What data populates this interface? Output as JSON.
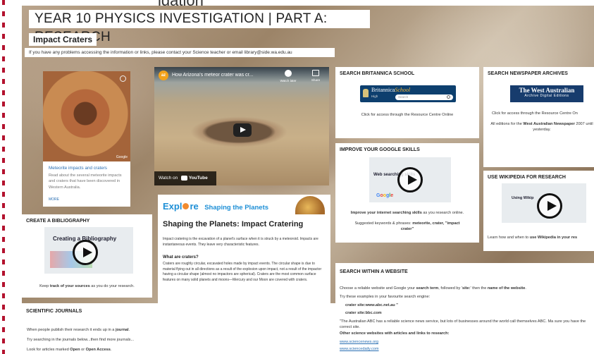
{
  "page_title": "YEAR 10 PHYSICS INVESTIGATION | PART A: RESEARCH",
  "section_heading": "Impact Craters",
  "help_text": "If you have any problems accessing the information or links, please contact your Science teacher or email library@side.wa.edu.au",
  "map_card": {
    "google_label": "Google",
    "link_title": "Meteorite impacts and craters",
    "description": "Read about the several meteorite impacts and craters that have been discovered in Western Australia.",
    "more": "MORE"
  },
  "video_card": {
    "channel_badge": "az",
    "title": "How Arizona's meteor crater was cr...",
    "watch_later": "Watch later",
    "share": "Share",
    "watch_on": "Watch on",
    "youtube": "YouTube"
  },
  "britannica": {
    "title": "SEARCH BRITANNICA SCHOOL",
    "logo_text": "Britannica",
    "logo_suffix": "School",
    "logo_level": "High",
    "search_placeholder": "Search",
    "caption": "Click for access through the Resource Centre Online"
  },
  "newspaper": {
    "title": "SEARCH NEWSPAPER ARCHIVES",
    "logo_line1": "The West Australian",
    "logo_line2": "Archive Digital Editions",
    "caption1": "Click for access through the Resource Centre On",
    "caption2_pre": "All editions for the ",
    "caption2_bold": "West Australian Newspaper",
    "caption2_post": " 2007 until yesterday."
  },
  "google_skills": {
    "title": "IMPROVE YOUR GOOGLE SKILLS",
    "thumb_text": "Web searching skills",
    "line1_bold": "Improve your internet searching skills",
    "line1_rest": " as you research online.",
    "line2_pre": "Suggested keywords & phrases: ",
    "line2_bold": "meteorite, crater, \"impact crater\""
  },
  "wikipedia": {
    "title": "USE WIKIPEDIA FOR RESEARCH",
    "thumb_text": "Using Wikip",
    "caption_pre": "Learn how and when to ",
    "caption_bold": "use Wikipedia in your res"
  },
  "bibliography": {
    "title": "CREATE A BIBLIOGRAPHY",
    "thumb_text": "Creating a Bibliography",
    "caption_pre": "Keep ",
    "caption_bold": "track of your sources",
    "caption_post": " as you do your research."
  },
  "explore": {
    "logo_a": "Expl",
    "logo_b": "re",
    "banner": "Shaping the Planets",
    "heading": "Shaping the Planets: Impact Cratering",
    "intro": "Impact cratering is the excavation of a planet's surface when it is struck by a meteoroid. Impacts are instantaneous events. They leave very characteristic features.",
    "subheading": "What are craters?",
    "body": "Craters are roughly circular, excavated holes made by impact events. The circular shape is due to material flying out in all directions as a result of the explosion upon impact, not a result of the impactor having a circular shape (almost no impactors are spherical). Craters are the most common surface features on many solid planets and moons—Mercury and our Moon are covered with craters."
  },
  "journals": {
    "title": "SCIENTIFIC JOURNALS",
    "line1_pre": "When people publish their research it ends up in a ",
    "line1_bold": "journal",
    "line1_post": ".",
    "line2": "Try searching in the journals below...then find more journals...",
    "line3_pre": "Look for articles marked ",
    "line3_b1": "Open",
    "line3_mid": " or ",
    "line3_b2": "Open Access",
    "line3_post": "."
  },
  "website": {
    "title": "SEARCH WITHIN A WEBSITE",
    "line1_pre": "Choose a reliable website and Google your ",
    "line1_b1": "search term",
    "line1_mid": ", followed by '",
    "line1_b2": "site:",
    "line1_mid2": "' then the ",
    "line1_b3": "name of the website",
    "line1_post": ".",
    "line2": "Try these examples in your favourite search engine:",
    "example1": "crater site:www.abc.net.au \"",
    "example2": "crater site:bbc.com",
    "note": "\"The Australian ABC has a reliable science news service, but lots of businesses around the world call themselves ABC. Ma sure you have the correct site.",
    "line3": "Other science websites with articles and links to research:",
    "link1": "www.sciencenews.org",
    "link2": "www.sciencedaily.com"
  },
  "cut_heading": "igation"
}
